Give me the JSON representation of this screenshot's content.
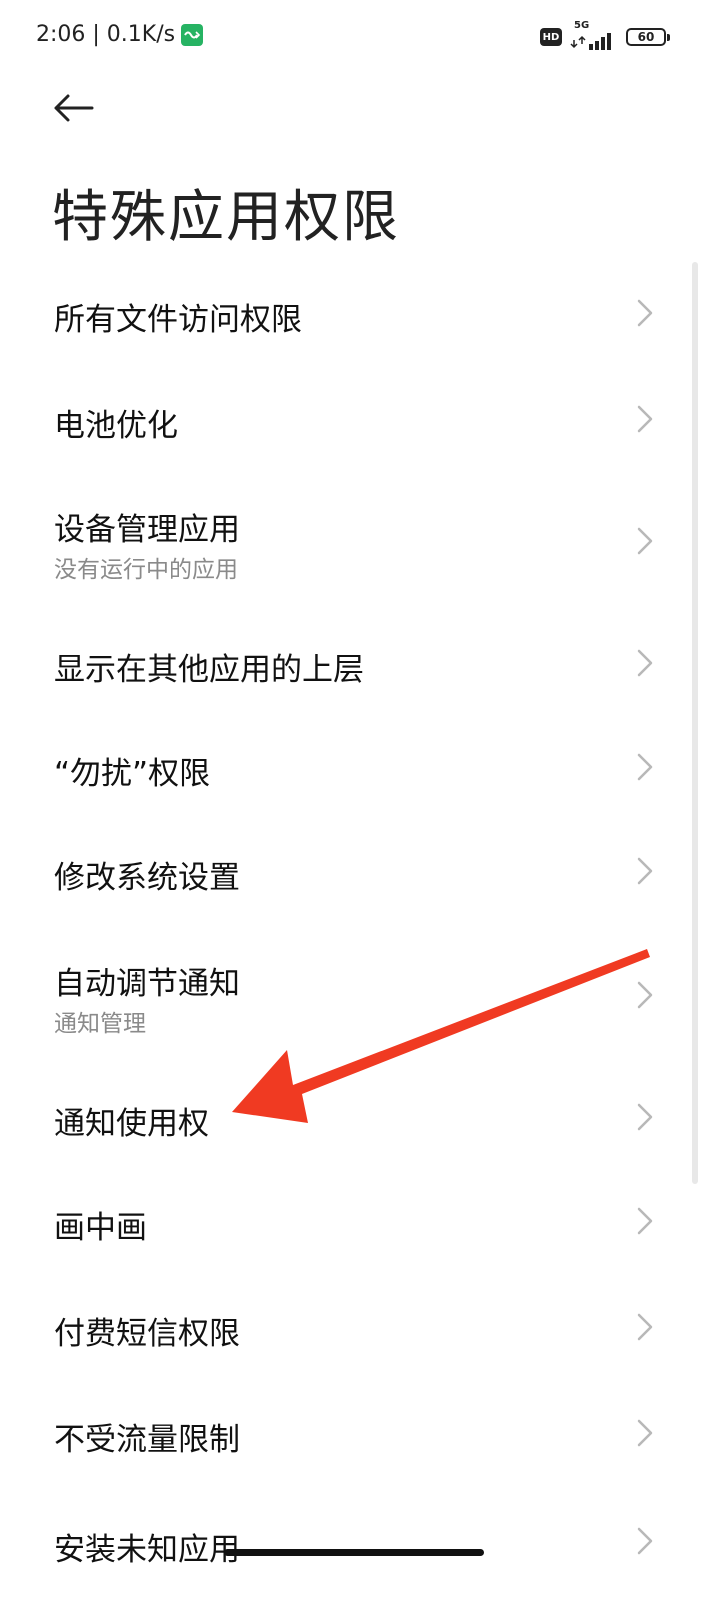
{
  "status_bar": {
    "time_speed": "2:06 | 0.1K/s",
    "hd_label": "HD",
    "network_label": "5G",
    "battery_level": "60"
  },
  "page": {
    "title": "特殊应用权限"
  },
  "items": [
    {
      "title": "所有文件访问权限",
      "subtitle": ""
    },
    {
      "title": "电池优化",
      "subtitle": ""
    },
    {
      "title": "设备管理应用",
      "subtitle": "没有运行中的应用"
    },
    {
      "title": "显示在其他应用的上层",
      "subtitle": ""
    },
    {
      "title": "“勿扰”权限",
      "subtitle": ""
    },
    {
      "title": "修改系统设置",
      "subtitle": ""
    },
    {
      "title": "自动调节通知",
      "subtitle": "通知管理"
    },
    {
      "title": "通知使用权",
      "subtitle": ""
    },
    {
      "title": "画中画",
      "subtitle": ""
    },
    {
      "title": "付费短信权限",
      "subtitle": ""
    },
    {
      "title": "不受流量限制",
      "subtitle": ""
    },
    {
      "title": "安装未知应用",
      "subtitle": ""
    }
  ],
  "icons": {
    "back": "arrow-left-icon",
    "chevron": "chevron-right-icon",
    "annotation": "red-arrow-annotation"
  },
  "colors": {
    "annotation_arrow": "#f03a22",
    "app_badge": "#26b363",
    "subtitle": "#8a8a8a"
  }
}
